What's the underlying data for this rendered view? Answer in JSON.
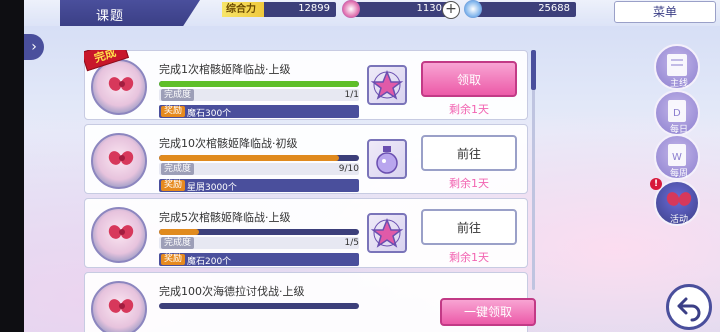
{
  "header": {
    "title": "课题",
    "power_label": "综合力",
    "power_value": "12899",
    "stone_value": "1130",
    "plus": "+",
    "star_value": "25688",
    "menu": "菜单"
  },
  "nav": {
    "left_arrow": "›"
  },
  "tasks": [
    {
      "title": "完成1次棺骸姬降临战·上级",
      "done_tag": "完成",
      "progress_label": "完成度",
      "progress_count": "1/1",
      "progress_fraction": 1.0,
      "progress_color": "#5fbf2a",
      "reward_label": "奖励",
      "reward": "魔石300个",
      "item_icon": "magic-stone-icon",
      "action": "领取",
      "action_type": "claim",
      "remaining": "剩余1天"
    },
    {
      "title": "完成10次棺骸姬降临战·初级",
      "progress_label": "完成度",
      "progress_count": "9/10",
      "progress_fraction": 0.9,
      "progress_color": "#e08a1e",
      "reward_label": "奖励",
      "reward": "星屑3000个",
      "item_icon": "stardust-bottle-icon",
      "action": "前往",
      "action_type": "go",
      "remaining": "剩余1天"
    },
    {
      "title": "完成5次棺骸姬降临战·上级",
      "progress_label": "完成度",
      "progress_count": "1/5",
      "progress_fraction": 0.2,
      "progress_color": "#e08a1e",
      "reward_label": "奖励",
      "reward": "魔石200个",
      "item_icon": "magic-stone-icon",
      "action": "前往",
      "action_type": "go",
      "remaining": "剩余1天"
    },
    {
      "title": "完成100次海德拉讨伐战·上级"
    }
  ],
  "categories": [
    {
      "label": "主线",
      "icon": "main-story-icon"
    },
    {
      "label": "每日",
      "icon": "daily-icon"
    },
    {
      "label": "每周",
      "icon": "weekly-icon"
    },
    {
      "label": "活动",
      "icon": "event-icon",
      "active": true,
      "alert": "!"
    }
  ],
  "footer": {
    "claim_all": "一键领取",
    "back_icon": "back-arrow-icon"
  }
}
